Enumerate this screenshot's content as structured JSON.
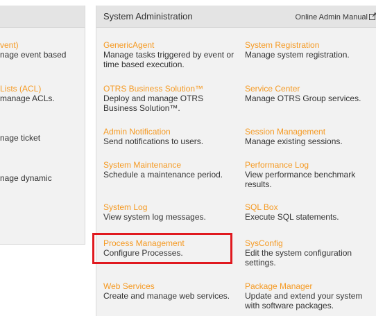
{
  "left_panel": {
    "entries": [
      {
        "title": "vent)",
        "desc": "nage event based"
      },
      {
        "title": "Lists (ACL)",
        "desc": "manage ACLs."
      },
      {
        "title": "",
        "desc": "nage ticket"
      },
      {
        "title": "",
        "desc": "nage dynamic"
      }
    ]
  },
  "main_panel": {
    "title": "System Administration",
    "manual_link": "Online Admin Manual",
    "entries": [
      {
        "title": "GenericAgent",
        "desc": "Manage tasks triggered by event or time based execution."
      },
      {
        "title": "System Registration",
        "desc": "Manage system registration."
      },
      {
        "title": "OTRS Business Solution™",
        "desc": "Deploy and manage OTRS Business Solution™."
      },
      {
        "title": "Service Center",
        "desc": "Manage OTRS Group services."
      },
      {
        "title": "Admin Notification",
        "desc": "Send notifications to users."
      },
      {
        "title": "Session Management",
        "desc": "Manage existing sessions."
      },
      {
        "title": "System Maintenance",
        "desc": "Schedule a maintenance period."
      },
      {
        "title": "Performance Log",
        "desc": "View performance benchmark results."
      },
      {
        "title": "System Log",
        "desc": "View system log messages."
      },
      {
        "title": "SQL Box",
        "desc": "Execute SQL statements."
      },
      {
        "title": "Process Management",
        "desc": "Configure Processes."
      },
      {
        "title": "SysConfig",
        "desc": "Edit the system configuration settings."
      },
      {
        "title": "Web Services",
        "desc": "Create and manage web services."
      },
      {
        "title": "Package Manager",
        "desc": "Update and extend your system with software packages."
      }
    ]
  },
  "colors": {
    "link": "#f59a23",
    "text": "#333333",
    "panel_bg": "#f2f2f2",
    "header_bg": "#e4e4e4",
    "highlight": "#e0191f"
  },
  "icons": {
    "manual_link": "external-link-icon"
  }
}
